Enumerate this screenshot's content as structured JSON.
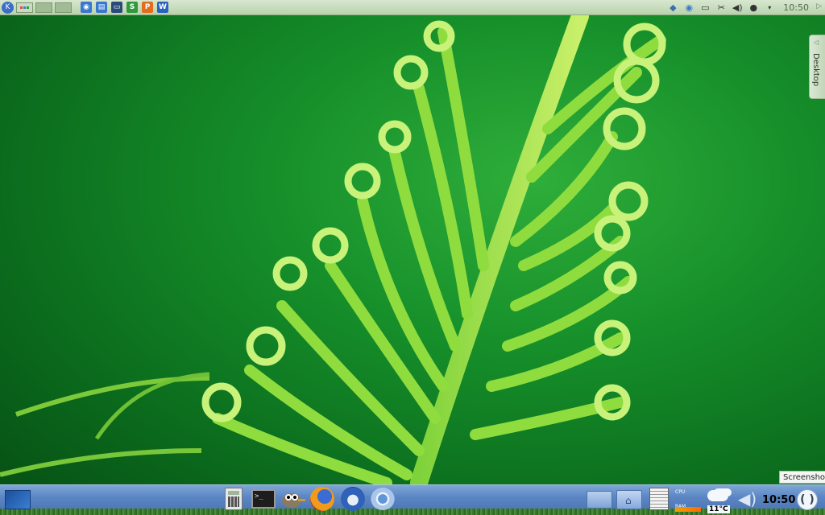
{
  "top_panel": {
    "kmenu_icon": "kde-logo-icon",
    "pager_icons": [
      "pager-desktop-1",
      "pager-desktop-2",
      "pager-desktop-3"
    ],
    "quicklaunch": [
      {
        "name": "chromium-icon",
        "glyph": "◉",
        "color": "#3a78d0"
      },
      {
        "name": "file-manager-icon",
        "glyph": "▤",
        "color": "#3a78d0"
      },
      {
        "name": "monitor-icon",
        "glyph": "▭",
        "color": "#2a4a7a"
      },
      {
        "name": "spreadsheet-icon",
        "glyph": "S",
        "color": "#2e9a3c"
      },
      {
        "name": "presentation-icon",
        "glyph": "P",
        "color": "#e46c1c"
      },
      {
        "name": "writer-icon",
        "glyph": "W",
        "color": "#2a62c0"
      }
    ],
    "tray_icons": [
      "python-icon",
      "chromium-tray-icon",
      "keyboard-icon",
      "scissors-icon",
      "volume-tray-icon",
      "tux-icon",
      "dropdown-arrow-icon"
    ],
    "clock": "10:50"
  },
  "desktop_tab": {
    "label": "Desktop"
  },
  "tooltip": {
    "text": "Screenshot"
  },
  "dock": {
    "apps": [
      "launcher",
      "calculator",
      "terminal",
      "gimp",
      "firefox",
      "thunderbird",
      "chromium",
      "folder",
      "home-folder",
      "text-editor"
    ],
    "terminal_prompt": ">_",
    "sysmon": {
      "cpu": "CPU",
      "ram": "RAM"
    },
    "weather_temp": "11°C",
    "clock": "10:50",
    "colors": {
      "dock_top": "#7fa6d8",
      "dock_bottom": "#476fae"
    }
  }
}
